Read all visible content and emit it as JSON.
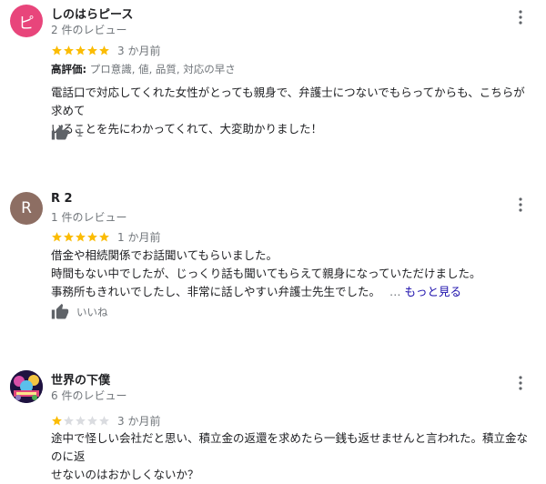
{
  "colors": {
    "star_filled": "#fbbc04",
    "star_empty": "#dadce0",
    "avatar_pink": "#e8457b",
    "avatar_brown": "#8d6e63",
    "link": "#1a0dab"
  },
  "reviews": [
    {
      "avatar_letter": "ピ",
      "name": "しのはらピース",
      "review_count": "2 件のレビュー",
      "rating": 5,
      "time": "3 か月前",
      "highlights_label": "高評価:",
      "highlights_values": "プロ意識, 値, 品質, 対応の早さ",
      "body_lines": [
        "電話口で対応してくれた女性がとっても親身で、弁護士につないでもらってからも、こちらが求めて",
        "いることを先にわかってくれて、大変助かりました！"
      ],
      "likes": "1",
      "menu_icon": "more-vert-icon"
    },
    {
      "avatar_letter": "R",
      "name": "R 2",
      "review_count": "1 件のレビュー",
      "rating": 5,
      "time": "1 か月前",
      "body_lines": [
        "借金や相続関係でお話聞いてもらいました。",
        "時間もない中でしたが、じっくり話も聞いてもらえて親身になっていただけました。",
        "事務所もきれいでしたし、非常に話しやすい弁護士先生でした。"
      ],
      "ellipsis": "…",
      "more_label": "もっと見る",
      "like_label": "いいね",
      "menu_icon": "more-vert-icon"
    },
    {
      "avatar_letter": "",
      "name": "世界の下僕",
      "review_count": "6 件のレビュー",
      "rating": 1,
      "time": "3 か月前",
      "body_lines": [
        "途中で怪しい会社だと思い、積立金の返還を求めたら一銭も返せませんと言われた。積立金なのに返",
        "せないのはおかしくないか？"
      ],
      "menu_icon": "more-vert-icon"
    }
  ]
}
